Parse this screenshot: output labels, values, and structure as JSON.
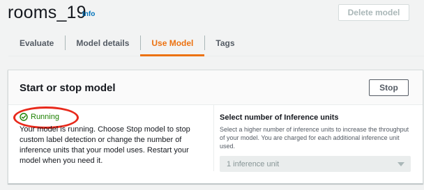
{
  "header": {
    "title": "rooms_19",
    "info_link": "Info",
    "delete_button": "Delete model"
  },
  "tabs": [
    {
      "label": "Evaluate",
      "active": false
    },
    {
      "label": "Model details",
      "active": false
    },
    {
      "label": "Use Model",
      "active": true
    },
    {
      "label": "Tags",
      "active": false
    }
  ],
  "panel": {
    "title": "Start or stop model",
    "stop_button": "Stop",
    "status": {
      "label": "Running",
      "icon": "check-circle-icon",
      "color": "#1d8102"
    },
    "description": "Your model is running. Choose Stop model to stop custom label detection or change the number of inference units that your model uses. Restart your model when you need it.",
    "inference": {
      "label": "Select number of Inference units",
      "description": "Select a higher number of inference units to increase the throughput of your model. You are charged for each additional inference unit used.",
      "selected_value": "1 inference unit",
      "disabled": true
    }
  },
  "colors": {
    "accent": "#ec7211",
    "link": "#0073bb",
    "annotation_circle": "#e8291b"
  }
}
